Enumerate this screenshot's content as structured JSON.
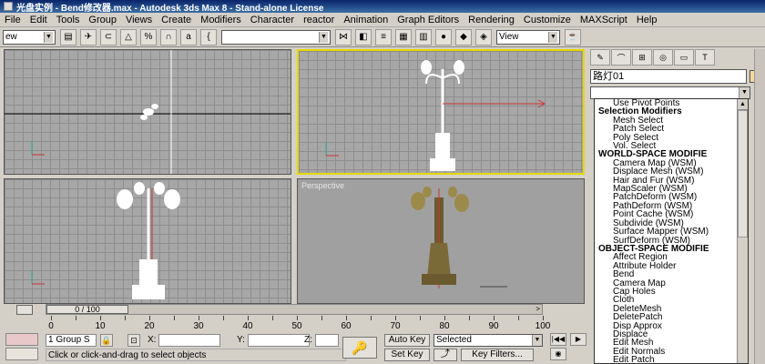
{
  "window": {
    "title": "光盘实例 - Bend修改器.max - Autodesk 3ds Max 8 - Stand-alone License"
  },
  "menu": [
    "File",
    "Edit",
    "Tools",
    "Group",
    "Views",
    "Create",
    "Modifiers",
    "Character",
    "reactor",
    "Animation",
    "Graph Editors",
    "Rendering",
    "Customize",
    "MAXScript",
    "Help"
  ],
  "toolbar": {
    "selection_filter": "ew",
    "named_selection": "",
    "view_dropdown": "View"
  },
  "viewports": {
    "top_label": "",
    "front_label": "",
    "left_label": "",
    "perspective_label": "Perspective"
  },
  "command_panel": {
    "object_name": "路灯01",
    "object_color": "#f6d99a",
    "modifier_list": [
      {
        "label": "Use Pivot Points",
        "type": "item"
      },
      {
        "label": "Selection Modifiers",
        "type": "header"
      },
      {
        "label": "Mesh Select",
        "type": "item"
      },
      {
        "label": "Patch Select",
        "type": "item"
      },
      {
        "label": "Poly Select",
        "type": "item"
      },
      {
        "label": "Vol. Select",
        "type": "item"
      },
      {
        "label": "WORLD-SPACE MODIFIE",
        "type": "header"
      },
      {
        "label": "Camera Map (WSM)",
        "type": "item"
      },
      {
        "label": "Displace Mesh (WSM)",
        "type": "item"
      },
      {
        "label": "Hair and Fur (WSM)",
        "type": "item"
      },
      {
        "label": "MapScaler (WSM)",
        "type": "item"
      },
      {
        "label": "PatchDeform (WSM)",
        "type": "item"
      },
      {
        "label": "PathDeform (WSM)",
        "type": "item"
      },
      {
        "label": "Point Cache (WSM)",
        "type": "item"
      },
      {
        "label": "Subdivide (WSM)",
        "type": "item"
      },
      {
        "label": "Surface Mapper (WSM)",
        "type": "item"
      },
      {
        "label": "SurfDeform (WSM)",
        "type": "item"
      },
      {
        "label": "OBJECT-SPACE MODIFIE",
        "type": "header"
      },
      {
        "label": "Affect Region",
        "type": "item"
      },
      {
        "label": "Attribute Holder",
        "type": "item"
      },
      {
        "label": "Bend",
        "type": "item"
      },
      {
        "label": "Camera Map",
        "type": "item"
      },
      {
        "label": "Cap Holes",
        "type": "item"
      },
      {
        "label": "Cloth",
        "type": "item"
      },
      {
        "label": "DeleteMesh",
        "type": "item"
      },
      {
        "label": "DeletePatch",
        "type": "item"
      },
      {
        "label": "Disp Approx",
        "type": "item"
      },
      {
        "label": "Displace",
        "type": "item"
      },
      {
        "label": "Edit Mesh",
        "type": "item"
      },
      {
        "label": "Edit Normals",
        "type": "item"
      },
      {
        "label": "Edit Patch",
        "type": "item"
      }
    ]
  },
  "timeline": {
    "slider_text": "0 / 100",
    "current_frame": 0,
    "total_frames": 100,
    "ticks": [
      "0",
      "10",
      "20",
      "30",
      "40",
      "50",
      "60",
      "70",
      "80",
      "90",
      "100"
    ]
  },
  "status": {
    "selection": "1 Group S",
    "prompt": "Click or click-and-drag to select objects",
    "x_label": "X:",
    "y_label": "Y:",
    "z_label": "Z:",
    "x_value": "",
    "y_value": "",
    "z_value": "",
    "auto_key": "Auto Key",
    "set_key": "Set Key",
    "key_mode": "Selected",
    "key_filters": "Key Filters..."
  }
}
